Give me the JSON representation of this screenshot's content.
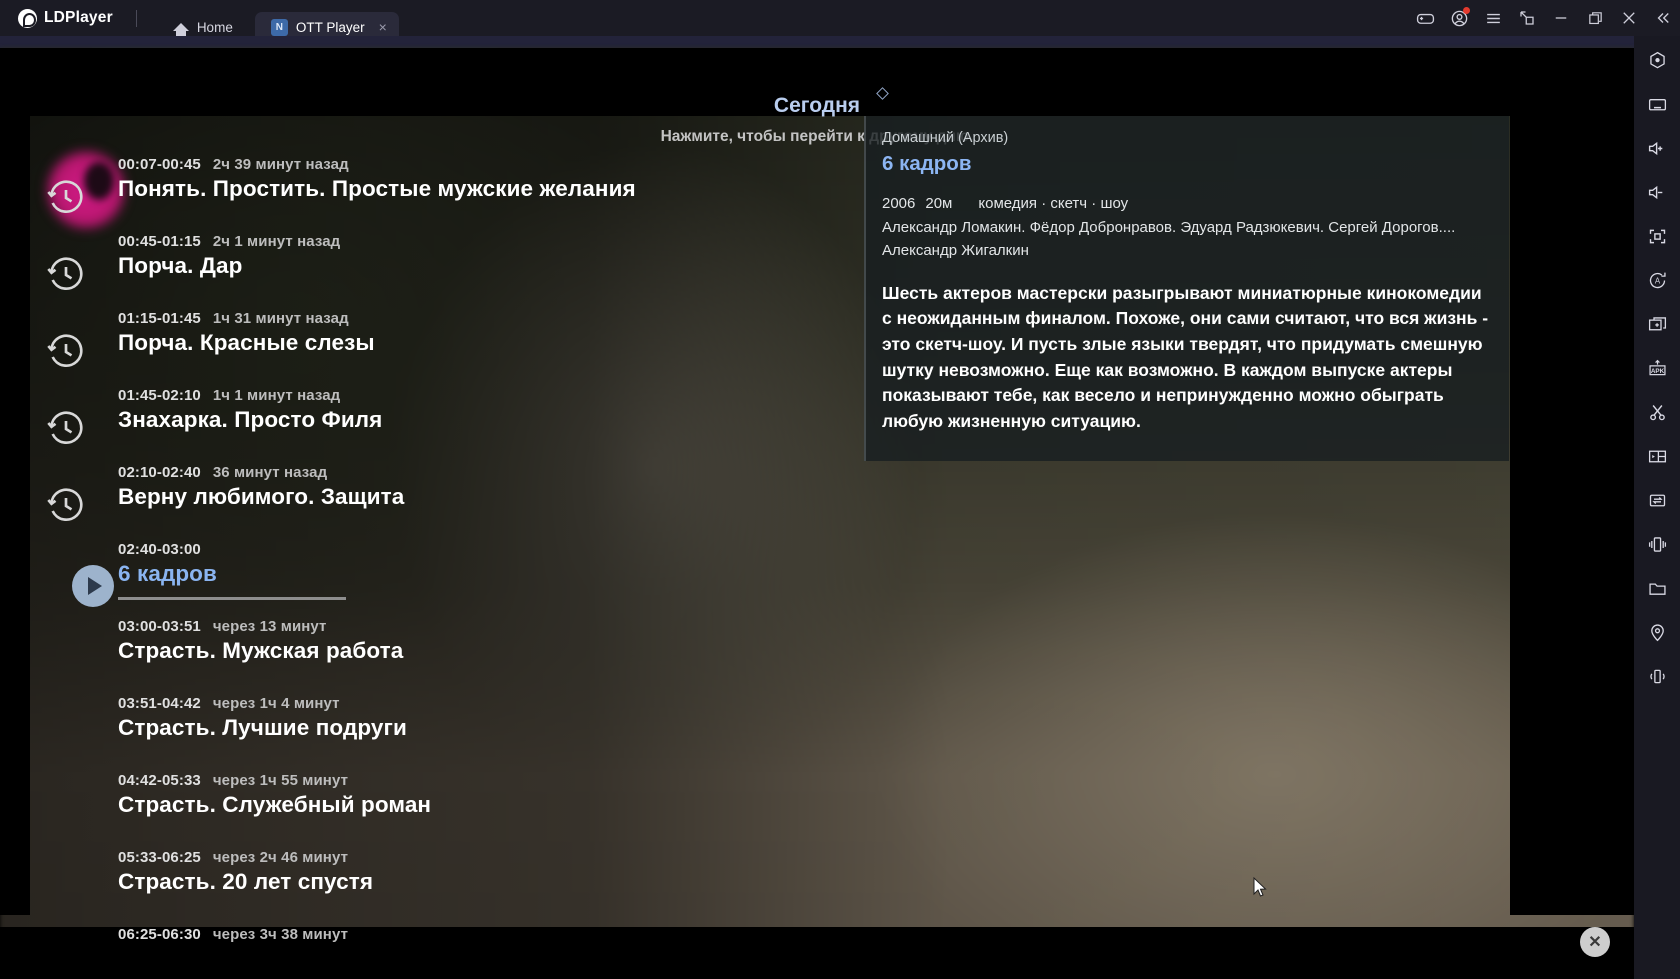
{
  "titlebar": {
    "brand": "LDPlayer",
    "tabs": [
      {
        "label": "Home",
        "icon": "home-icon",
        "active": false
      },
      {
        "label": "OTT Player",
        "icon": "app-icon",
        "active": true,
        "close": "×"
      }
    ],
    "controls": [
      {
        "name": "gamepad-icon"
      },
      {
        "name": "account-icon",
        "badge": true
      },
      {
        "name": "menu-icon"
      },
      {
        "name": "resize-icon"
      },
      {
        "name": "minimize-icon"
      },
      {
        "name": "maximize-icon"
      },
      {
        "name": "close-icon"
      },
      {
        "name": "collapse-rail-icon"
      }
    ]
  },
  "rail": {
    "items": [
      {
        "name": "hexagon-home-icon"
      },
      {
        "name": "keyboard-icon"
      },
      {
        "name": "volume-up-icon"
      },
      {
        "name": "volume-down-icon"
      },
      {
        "name": "fullscreen-icon"
      },
      {
        "name": "auto-rotate-icon"
      },
      {
        "name": "multi-instance-icon"
      },
      {
        "name": "apk-install-icon"
      },
      {
        "name": "scissors-icon"
      },
      {
        "name": "multi-window-icon"
      },
      {
        "name": "sync-transfer-icon"
      },
      {
        "name": "shake-icon"
      },
      {
        "name": "folder-icon"
      },
      {
        "name": "location-icon"
      },
      {
        "name": "vibrate-icon"
      }
    ]
  },
  "app": {
    "header": {
      "today": "Сегодня",
      "hint": "Нажмите, чтобы перейти к другому дню."
    },
    "programs": [
      {
        "time": "00:07-00:45",
        "relative": "2ч 39 минут назад",
        "title": "Понять. Простить. Простые мужские желания",
        "state": "past"
      },
      {
        "time": "00:45-01:15",
        "relative": "2ч 1 минут назад",
        "title": "Порча. Дар",
        "state": "past"
      },
      {
        "time": "01:15-01:45",
        "relative": "1ч 31 минут назад",
        "title": "Порча. Красные слезы",
        "state": "past"
      },
      {
        "time": "01:45-02:10",
        "relative": "1ч 1 минут назад",
        "title": "Знахарка. Просто Филя",
        "state": "past"
      },
      {
        "time": "02:10-02:40",
        "relative": "36 минут назад",
        "title": "Верну любимого. Защита",
        "state": "past"
      },
      {
        "time": "02:40-03:00",
        "relative": "",
        "title": "6 кадров",
        "state": "current"
      },
      {
        "time": "03:00-03:51",
        "relative": "через 13 минут",
        "title": "Страсть. Мужская работа",
        "state": "future"
      },
      {
        "time": "03:51-04:42",
        "relative": "через 1ч 4 минут",
        "title": "Страсть. Лучшие подруги",
        "state": "future"
      },
      {
        "time": "04:42-05:33",
        "relative": "через 1ч 55 минут",
        "title": "Страсть. Служебный роман",
        "state": "future"
      },
      {
        "time": "05:33-06:25",
        "relative": "через 2ч 46 минут",
        "title": "Страсть. 20 лет спустя",
        "state": "future"
      },
      {
        "time": "06:25-06:30",
        "relative": "через 3ч 38 минут",
        "title": "",
        "state": "future"
      }
    ],
    "info": {
      "channel": "Домашний (Архив)",
      "title": "6 кадров",
      "year": "2006",
      "duration": "20м",
      "genres": "комедия · скетч · шоу",
      "cast": "Александр Ломакин. Фёдор Добронравов. Эдуард Радзюкевич. Сергей Дорогов.... Александр Жигалкин",
      "description": "Шесть актеров мастерски разыгрывают миниатюрные кинокомедии с неожиданным финалом. Похоже, они сами считают, что вся жизнь - это скетч-шоу. И пусть злые языки твердят, что придумать смешную шутку невозможно. Еще как возможно. В каждом выпуске актеры показывают тебе, как весело и непринужденно можно обыграть любую жизненную ситуацию."
    },
    "float_close_label": "✕"
  },
  "colors": {
    "accent_blue": "#8cb5f2",
    "today_blue": "#b9cdee",
    "titlebar_bg": "#1b1b24",
    "rail_bg": "#191922",
    "badge_red": "#e33a2e"
  }
}
